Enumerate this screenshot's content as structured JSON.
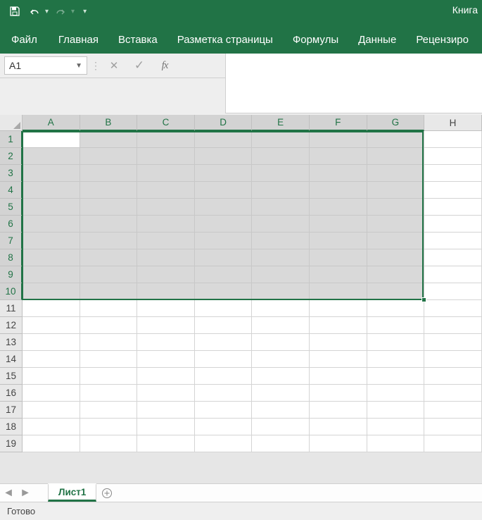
{
  "titlebar": {
    "document_name": "Книга"
  },
  "qat": {
    "save": "save",
    "undo": "undo",
    "redo": "redo"
  },
  "ribbon": {
    "tabs": [
      "Файл",
      "Главная",
      "Вставка",
      "Разметка страницы",
      "Формулы",
      "Данные",
      "Рецензиро"
    ],
    "active_index": -1
  },
  "formula_bar": {
    "name_box": "A1",
    "cancel": "✕",
    "enter": "✓",
    "fx": "fx",
    "formula": ""
  },
  "grid": {
    "columns": [
      "A",
      "B",
      "C",
      "D",
      "E",
      "F",
      "G",
      "H"
    ],
    "rows": [
      "1",
      "2",
      "3",
      "4",
      "5",
      "6",
      "7",
      "8",
      "9",
      "10",
      "11",
      "12",
      "13",
      "14",
      "15",
      "16",
      "17",
      "18",
      "19"
    ],
    "selected_columns": [
      "A",
      "B",
      "C",
      "D",
      "E",
      "F",
      "G"
    ],
    "selected_rows": [
      "1",
      "2",
      "3",
      "4",
      "5",
      "6",
      "7",
      "8",
      "9",
      "10"
    ],
    "active_cell": "A1",
    "selection": "A1:G10"
  },
  "sheets": {
    "tabs": [
      "Лист1"
    ],
    "active": 0
  },
  "statusbar": {
    "text": "Готово"
  }
}
